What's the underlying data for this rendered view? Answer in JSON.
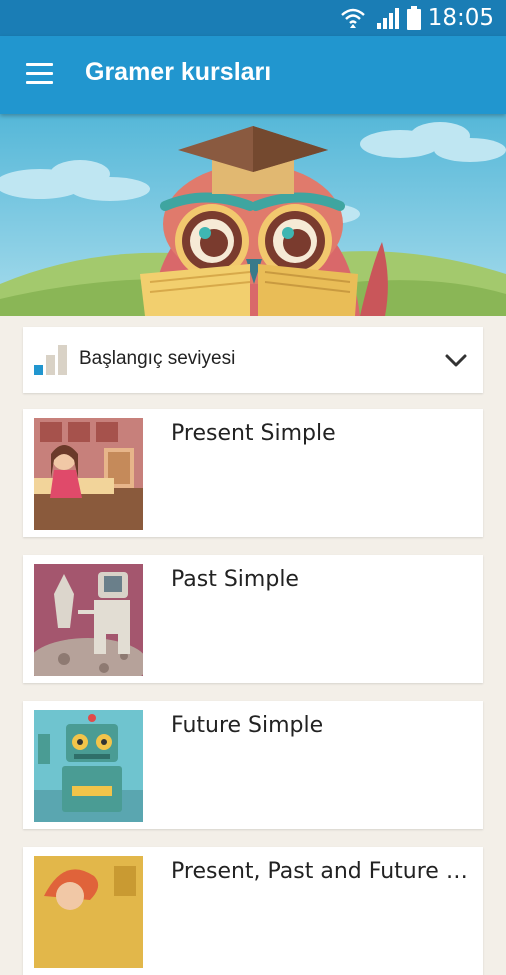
{
  "status_bar": {
    "time": "18:05"
  },
  "app_bar": {
    "title": "Gramer kursları"
  },
  "level_selector": {
    "label": "Başlangıç seviyesi"
  },
  "courses": [
    {
      "title": "Present Simple"
    },
    {
      "title": "Past Simple"
    },
    {
      "title": "Future Simple"
    },
    {
      "title": "Present, Past and Future C..."
    }
  ],
  "colors": {
    "primary": "#2196cf",
    "status_bar": "#1a7db5",
    "background": "#f3efe8"
  },
  "icons": [
    "wifi-icon",
    "signal-icon",
    "battery-icon",
    "menu-icon",
    "level-bars-icon",
    "chevron-down-icon"
  ]
}
